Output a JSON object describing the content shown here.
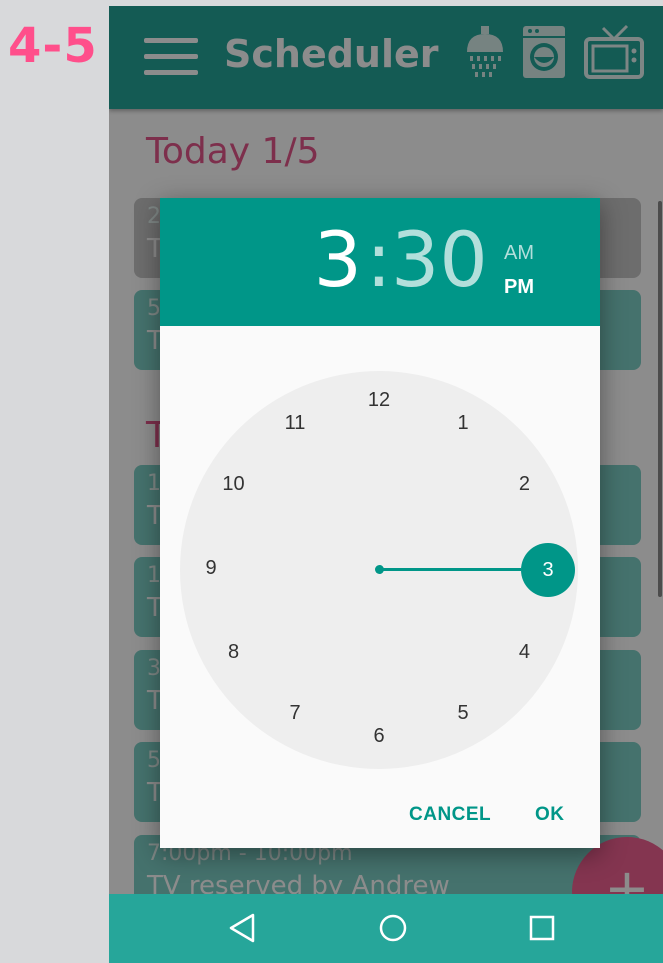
{
  "step_label": "4-5",
  "app_bar": {
    "title": "Scheduler",
    "menu_icon": "hamburger-menu-icon",
    "icons": [
      "shower-icon",
      "washing-machine-icon",
      "tv-icon"
    ]
  },
  "sections": [
    {
      "title": "Today 1/5"
    },
    {
      "title": "T"
    }
  ],
  "cards": [
    {
      "time": "2",
      "desc": "T"
    },
    {
      "time": "5",
      "desc": "T"
    },
    {
      "time": "1",
      "desc": "T"
    },
    {
      "time": "1",
      "desc": "T"
    },
    {
      "time": "3",
      "desc": "T"
    },
    {
      "time": "5",
      "desc": "T"
    },
    {
      "time": "7:00pm - 10:00pm",
      "desc": "TV reserved by Andrew"
    }
  ],
  "fab": {
    "label": "+"
  },
  "time_picker": {
    "hour": "3",
    "colon": ":",
    "minute": "30",
    "am_label": "AM",
    "pm_label": "PM",
    "selected_period": "PM",
    "selected_hour": "3",
    "clock_numbers": [
      "12",
      "1",
      "2",
      "3",
      "4",
      "5",
      "6",
      "7",
      "8",
      "9",
      "10",
      "11"
    ],
    "cancel_label": "CANCEL",
    "ok_label": "OK"
  },
  "nav_bar": {
    "icons": [
      "back-icon",
      "home-icon",
      "recents-icon"
    ]
  },
  "colors": {
    "primary": "#26a69a",
    "dialog_header": "#009688",
    "accent": "#f06292",
    "step_label": "#ff4f8b",
    "section_title": "#e4568a"
  }
}
